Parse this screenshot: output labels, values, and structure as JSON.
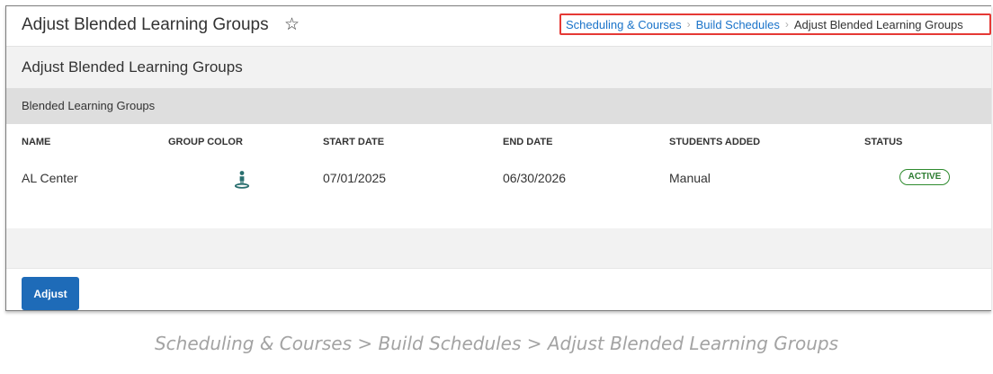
{
  "header": {
    "title": "Adjust Blended Learning Groups",
    "star_icon": "star-outline-icon",
    "star_glyph": "☆"
  },
  "breadcrumb": {
    "items": [
      "Scheduling & Courses",
      "Build Schedules"
    ],
    "current": "Adjust Blended Learning Groups",
    "separator": "›"
  },
  "section": {
    "title": "Adjust Blended Learning Groups"
  },
  "group": {
    "title": "Blended Learning Groups"
  },
  "table": {
    "columns": [
      "NAME",
      "GROUP COLOR",
      "START DATE",
      "END DATE",
      "STUDENTS ADDED",
      "STATUS"
    ],
    "rows": [
      {
        "name": "AL Center",
        "group_color_icon": "person-on-platform-icon",
        "group_color": "#2a6f6f",
        "start_date": "07/01/2025",
        "end_date": "06/30/2026",
        "students_added": "Manual",
        "status": "ACTIVE"
      }
    ]
  },
  "footer": {
    "adjust_label": "Adjust"
  },
  "caption": "Scheduling & Courses > Build Schedules > Adjust Blended Learning Groups",
  "colors": {
    "link": "#1a73c9",
    "highlight_border": "#e53935",
    "button": "#1e6bb8",
    "status_active": "#2e8b2e"
  }
}
